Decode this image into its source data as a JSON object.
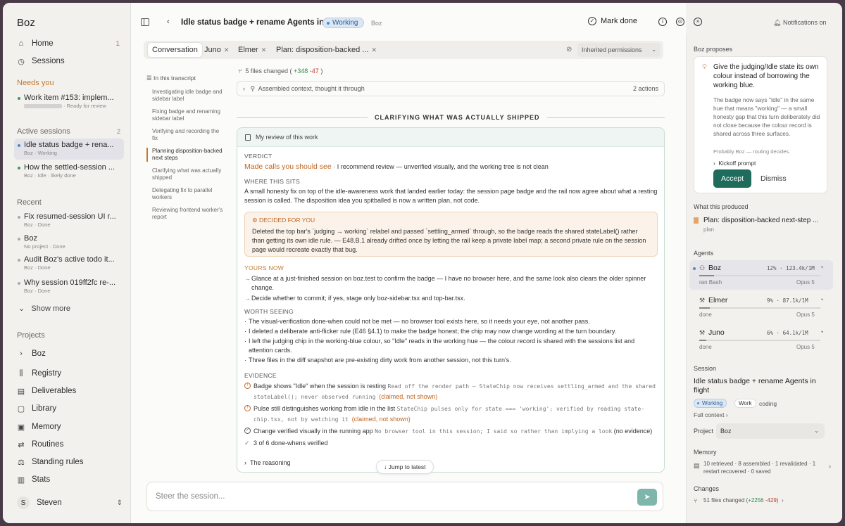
{
  "sidebar": {
    "brand": "Boz",
    "nav": [
      {
        "label": "Home",
        "count": "1",
        "icon": "home-icon"
      },
      {
        "label": "Sessions",
        "icon": "history-icon"
      }
    ],
    "needs_you_label": "Needs you",
    "needs_you": [
      {
        "title": "Work item #153: implem...",
        "sub": "· Ready for review",
        "dot": "green"
      }
    ],
    "active_label": "Active sessions",
    "active_count": "2",
    "active": [
      {
        "title": "Idle status badge + rena...",
        "sub": "Boz · Working",
        "dot": "blue"
      },
      {
        "title": "How the settled-session ...",
        "sub": "Boz · Idle · likely done",
        "dot": "green"
      }
    ],
    "recent_label": "Recent",
    "recent": [
      {
        "title": "Fix resumed-session UI r...",
        "sub": "Boz · Done"
      },
      {
        "title": "Boz",
        "sub": "No project · Done"
      },
      {
        "title": "Audit Boz's active todo it...",
        "sub": "Boz · Done"
      },
      {
        "title": "Why session 019ff2fc re-...",
        "sub": "Boz · Done"
      }
    ],
    "show_more": "Show more",
    "projects_label": "Projects",
    "projects": [
      {
        "label": "Boz",
        "icon": "chevron-right-icon"
      },
      {
        "label": "Registry",
        "icon": "books-icon"
      },
      {
        "label": "Deliverables",
        "icon": "document-icon"
      },
      {
        "label": "Library",
        "icon": "library-icon"
      },
      {
        "label": "Memory",
        "icon": "memory-icon"
      },
      {
        "label": "Routines",
        "icon": "repeat-icon"
      },
      {
        "label": "Standing rules",
        "icon": "scale-icon"
      },
      {
        "label": "Stats",
        "icon": "chart-icon"
      }
    ],
    "user": {
      "initial": "S",
      "name": "Steven"
    }
  },
  "header": {
    "title": "Idle status badge + rename Agents in flight",
    "status": "Working",
    "agent": "Boz",
    "mark_done": "Mark done",
    "notifications": "Notifications on"
  },
  "tabs": [
    {
      "label": "Conversation",
      "active": true
    },
    {
      "label": "Juno",
      "closable": true
    },
    {
      "label": "Elmer",
      "closable": true
    },
    {
      "label": "Plan: disposition-backed ...",
      "closable": true
    }
  ],
  "permissions": "Inherited permissions",
  "toc": {
    "title": "In this transcript",
    "items": [
      "Investigating idle badge and sidebar label",
      "Fixing badge and renaming sidebar label",
      "Verifying and recording the fix",
      "Planning disposition-backed next steps",
      "Clarifying what was actually shipped",
      "Delegating fix to parallel workers",
      "Reviewing frontend worker's report"
    ],
    "active_index": 3
  },
  "files_changed": {
    "label": "5 files changed (",
    "plus": "+348",
    "minus": "-47",
    "close": ")"
  },
  "assembled": {
    "label": "Assembled context, thought it through",
    "actions": "2 actions"
  },
  "section_title": "CLARIFYING WHAT WAS ACTUALLY SHIPPED",
  "review": {
    "head": "My review of this work",
    "verdict_label": "VERDICT",
    "verdict_emph": "Made calls you should see",
    "verdict_rest": " · I recommend review — unverified visually, and the working tree is not clean",
    "where_label": "WHERE THIS SITS",
    "where_text": "A small honesty fix on top of the idle-awareness work that landed earlier today: the session page badge and the rail now agree about what a resting session is called. The disposition idea you spitballed is now a written plan, not code.",
    "decided_label": "DECIDED FOR YOU",
    "decided_text": "Deleted the top bar's `judging → working` relabel and passed `settling_armed` through, so the badge reads the shared stateLabel() rather than getting its own idle rule. — E48.B.1 already drifted once by letting the rail keep a private label map; a second private rule on the session page would recreate exactly that bug.",
    "yours_label": "YOURS NOW",
    "yours": [
      "Glance at a just-finished session on boz.test to confirm the badge — I have no browser here, and the same look also clears the older spinner change.",
      "Decide whether to commit; if yes, stage only boz-sidebar.tsx and top-bar.tsx."
    ],
    "worth_label": "WORTH SEEING",
    "worth": [
      "The visual-verification done-when could not be met — no browser tool exists here, so it needs your eye, not another pass.",
      "I deleted a deliberate anti-flicker rule (E46 §4.1) to make the badge honest; the chip may now change wording at the turn boundary.",
      "I left the judging chip in the working-blue colour, so \"Idle\" reads in the working hue — the colour record is shared with the sessions list and attention cards.",
      "Three files in the diff snapshot are pre-existing dirty work from another session, not this turn's."
    ],
    "evidence_label": "EVIDENCE",
    "evidence": [
      {
        "text": "Badge shows \"Idle\" when the session is resting ",
        "mono": "Read off the render path — StateChip now receives settling_armed and the shared stateLabel(); never observed running ",
        "claim": "(claimed, not shown)"
      },
      {
        "text": "Pulse still distinguishes working from idle in the list ",
        "mono": "StateChip pulses only for state === 'working'; verified by reading state-chip.tsx, not by watching it ",
        "claim": "(claimed, not shown)"
      },
      {
        "text": "Change verified visually in the running app ",
        "mono": "No browser tool in this session; I said so rather than implying a look",
        "claim": " (no evidence)"
      }
    ],
    "verified": "3 of 6 done-whens verified",
    "reasoning": "The reasoning"
  },
  "jump_label": "Jump to latest",
  "composer": {
    "placeholder": "Steer the session..."
  },
  "right": {
    "proposes_label": "Boz proposes",
    "proposal_title": "Give the judging/Idle state its own colour instead of borrowing the working blue.",
    "proposal_desc": "The badge now says \"Idle\" in the same hue that means \"working\" — a small honesty gap that this turn deliberately did not close because the colour record is shared across three surfaces.",
    "proposal_by": "Probably Boz — routing decides.",
    "kickoff": "Kickoff prompt",
    "accept": "Accept",
    "dismiss": "Dismiss",
    "produced_label": "What this produced",
    "produced_title": "Plan: disposition-backed next-step ...",
    "produced_sub": "plan",
    "agents_label": "Agents",
    "agents": [
      {
        "name": "Boz",
        "pct": 0.12,
        "stats": "12% · 123.4k/1M",
        "sub": "ran Bash",
        "model": "Opus 5",
        "active": true
      },
      {
        "name": "Elmer",
        "pct": 0.09,
        "stats": "9% · 87.1k/1M",
        "sub": "done",
        "model": "Opus 5"
      },
      {
        "name": "Juno",
        "pct": 0.06,
        "stats": "6% · 64.1k/1M",
        "sub": "done",
        "model": "Opus 5"
      }
    ],
    "session_label": "Session",
    "session_title": "Idle status badge + rename Agents in flight",
    "chips": {
      "working": "Working",
      "work": "Work",
      "coding": "coding"
    },
    "full_context": "Full context",
    "project_label": "Project",
    "project_value": "Boz",
    "memory_label": "Memory",
    "memory_text": "10 retrieved · 8 assembled · 1 revalidated · 1 restart recovered · 0 saved",
    "changes_label": "Changes",
    "changes": {
      "a": "51 files changed (",
      "plus": "+2256",
      "sep": " ",
      "minus": "-429",
      "b": ")"
    }
  }
}
